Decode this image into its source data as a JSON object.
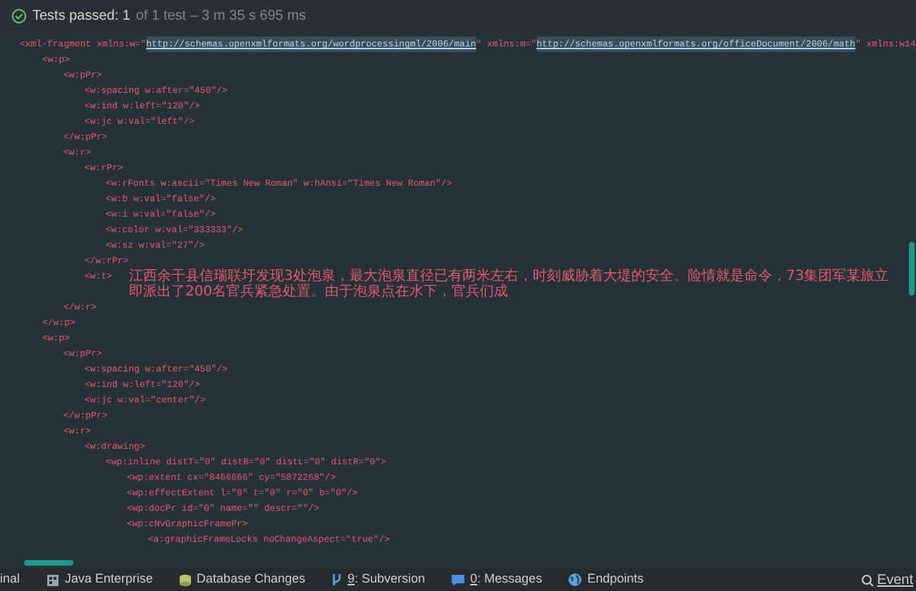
{
  "test_bar": {
    "status": "Tests passed: 1",
    "detail": "of 1 test – 3 m 35 s 695 ms"
  },
  "editor": {
    "root": {
      "parts": [
        {
          "kind": "tag",
          "text": "<xml-fragment xmlns:w=\""
        },
        {
          "kind": "url",
          "text": "http://schemas.openxmlformats.org/wordprocessingml/2006/main"
        },
        {
          "kind": "tag",
          "text": "\" xmlns:m=\""
        },
        {
          "kind": "url",
          "text": "http://schemas.openxmlformats.org/officeDocument/2006/math"
        },
        {
          "kind": "tag",
          "text": "\" xmlns:w14"
        }
      ],
      "children": [
        {
          "open": "<w:p>",
          "close": "</w:p>",
          "children": [
            {
              "open": "<w:pPr>",
              "close": "</w:pPr>",
              "children": [
                {
                  "open": "<w:spacing w:after=\"450\"/>"
                },
                {
                  "open": "<w:ind w:left=\"120\"/>"
                },
                {
                  "open": "<w:jc w:val=\"left\"/>"
                }
              ]
            },
            {
              "open": "<w:r>",
              "close": "</w:r>",
              "children": [
                {
                  "open": "<w:rPr>",
                  "close": "</w:rPr>",
                  "children": [
                    {
                      "open": "<w:rFonts w:ascii=\"Times New Roman\" w:hAnsi=\"Times New Roman\"/>"
                    },
                    {
                      "open": "<w:b w:val=\"false\"/>"
                    },
                    {
                      "open": "<w:i w:val=\"false\"/>"
                    },
                    {
                      "open": "<w:color w:val=\"333333\"/>"
                    },
                    {
                      "open": "<w:sz w:val=\"27\"/>"
                    }
                  ]
                },
                {
                  "open": "<w:t>",
                  "content": "江西余干县信瑞联圩发现3处泡泉，最大泡泉直径已有两米左右，时刻威胁着大堤的安全。险情就是命令，73集团军某旅立即派出了200名官兵紧急处置。由于泡泉点在水下，官兵们成"
                }
              ]
            }
          ]
        },
        {
          "open": "<w:p>",
          "children": [
            {
              "open": "<w:pPr>",
              "close": "</w:pPr>",
              "children": [
                {
                  "open": "<w:spacing w:after=\"450\"/>"
                },
                {
                  "open": "<w:ind w:left=\"120\"/>"
                },
                {
                  "open": "<w:jc w:val=\"center\"/>"
                }
              ]
            },
            {
              "open": "<w:r>",
              "children": [
                {
                  "open": "<w:drawing>",
                  "children": [
                    {
                      "open": "<wp:inline distT=\"0\" distB=\"0\" distL=\"0\" distR=\"0\">",
                      "children": [
                        {
                          "open": "<wp:extent cx=\"8466666\" cy=\"5872268\"/>"
                        },
                        {
                          "open": "<wp:effectExtent l=\"0\" t=\"0\" r=\"0\" b=\"0\"/>"
                        },
                        {
                          "open": "<wp:docPr id=\"0\" name=\"\" descr=\"\"/>"
                        },
                        {
                          "open": "<wp:cNvGraphicFramePr>",
                          "children": [
                            {
                              "open": "<a:graphicFrameLocks noChangeAspect=\"true\"/>"
                            }
                          ]
                        }
                      ]
                    }
                  ]
                }
              ]
            }
          ]
        }
      ]
    }
  },
  "status_bar": {
    "items": [
      {
        "kind": "text",
        "label": "inal"
      },
      {
        "kind": "enterprise",
        "label": "Java Enterprise"
      },
      {
        "kind": "database",
        "label": "Database Changes"
      },
      {
        "kind": "vcs",
        "shortcut": "9",
        "label": ": Subversion"
      },
      {
        "kind": "messages",
        "shortcut": "0",
        "label": ": Messages"
      },
      {
        "kind": "globe",
        "label": "Endpoints"
      }
    ],
    "right": "Event"
  }
}
